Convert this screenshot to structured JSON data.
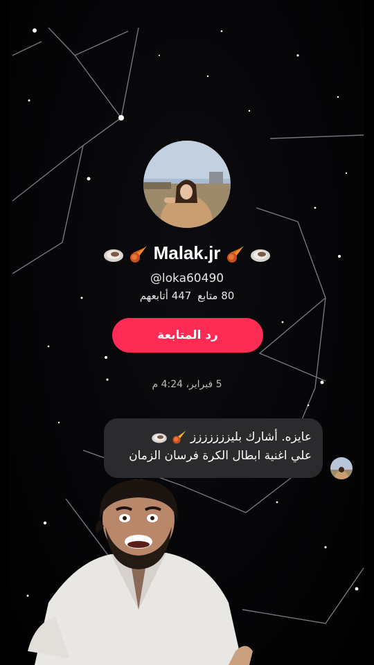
{
  "profile": {
    "display_name": "Malak.jr",
    "username": "@loka60490",
    "followers_text": "447 أتابعهم",
    "following_text": "80 متابع",
    "follow_back_label": "رد المتابعة"
  },
  "chat": {
    "timestamp": "5 فبراير، 4:24 م",
    "message_line1": "عايزه. أشارك بليززززززز",
    "message_line2": "علي اغنية ابطال الكرة فرسان الزمان"
  },
  "colors": {
    "accent": "#fe2c55",
    "bubble": "#2b2b2d",
    "background": "#000000"
  },
  "icons": [
    "meteor-emoji",
    "oyster-emoji"
  ]
}
